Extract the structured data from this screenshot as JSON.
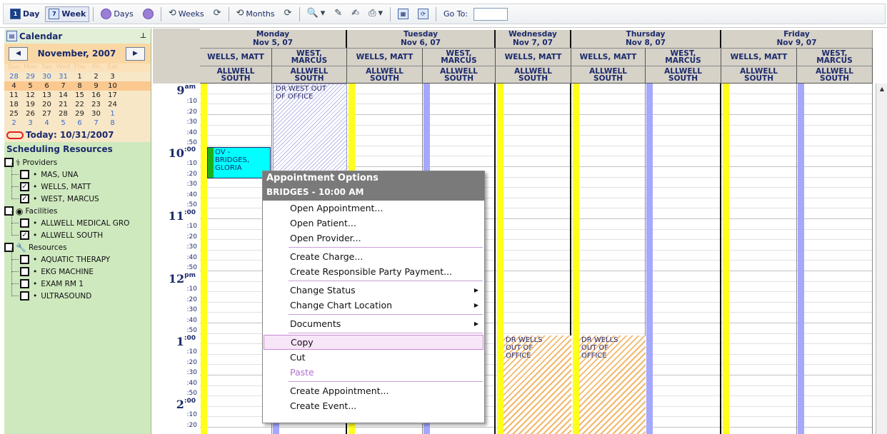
{
  "toolbar": {
    "day_label": "Day",
    "week_label": "Week",
    "days_label": "Days",
    "weeks_label": "Weeks",
    "months_label": "Months",
    "goto_label": "Go To:",
    "goto_value": ""
  },
  "sidebar": {
    "title": "Calendar",
    "month_label": "November, 2007",
    "dow": [
      "Sun",
      "Mon",
      "Tue",
      "Wed",
      "Thu",
      "Fri",
      "Sat"
    ],
    "weeks": [
      [
        "28",
        "29",
        "30",
        "31",
        "1",
        "2",
        "3"
      ],
      [
        "4",
        "5",
        "6",
        "7",
        "8",
        "9",
        "10"
      ],
      [
        "11",
        "12",
        "13",
        "14",
        "15",
        "16",
        "17"
      ],
      [
        "18",
        "19",
        "20",
        "21",
        "22",
        "23",
        "24"
      ],
      [
        "25",
        "26",
        "27",
        "28",
        "29",
        "30",
        "1"
      ],
      [
        "2",
        "3",
        "4",
        "5",
        "6",
        "7",
        "8"
      ]
    ],
    "today_label": "Today: 10/31/2007",
    "resources_title": "Scheduling Resources",
    "providers_label": "Providers",
    "providers": [
      {
        "name": "MAS, UNA",
        "checked": ""
      },
      {
        "name": "WELLS, MATT",
        "checked": "✓"
      },
      {
        "name": "WEST, MARCUS",
        "checked": "✓"
      }
    ],
    "facilities_label": "Facilities",
    "facilities": [
      {
        "name": "ALLWELL MEDICAL GRO",
        "checked": ""
      },
      {
        "name": "ALLWELL SOUTH",
        "checked": "✓"
      }
    ],
    "resources_label": "Resources",
    "resources": [
      {
        "name": "AQUATIC THERAPY",
        "checked": ""
      },
      {
        "name": "EKG MACHINE",
        "checked": ""
      },
      {
        "name": "EXAM RM 1",
        "checked": ""
      },
      {
        "name": "ULTRASOUND",
        "checked": ""
      }
    ]
  },
  "calendar": {
    "days": [
      {
        "name": "Monday",
        "date": "Nov 5, 07"
      },
      {
        "name": "Tuesday",
        "date": "Nov 6, 07"
      },
      {
        "name": "Wednesday",
        "date": "Nov 7, 07"
      },
      {
        "name": "Thursday",
        "date": "Nov 8, 07"
      },
      {
        "name": "Friday",
        "date": "Nov 9, 07"
      }
    ],
    "providers": {
      "wells": "WELLS, MATT",
      "west_l1": "WEST,",
      "west_l2": "MARCUS"
    },
    "facility": {
      "l1": "ALLWELL",
      "l2": "SOUTH"
    },
    "hours": [
      {
        "hour": "9",
        "suffix": "am"
      },
      {
        "hour": "10",
        "suffix": ":00"
      },
      {
        "hour": "11",
        "suffix": ":00"
      },
      {
        "hour": "12",
        "suffix": "pm"
      },
      {
        "hour": "1",
        "suffix": ":00"
      },
      {
        "hour": "2",
        "suffix": ":00"
      }
    ],
    "minutes": [
      ":10",
      ":20",
      ":30",
      ":40",
      ":50"
    ],
    "appointments": {
      "west_out_l1": "DR WEST OUT",
      "west_out_l2": "OF OFFICE",
      "ov_l1": "OV -",
      "ov_l2": "BRIDGES,",
      "ov_l3": "GLORIA",
      "wells_out_l1": "DR WELLS",
      "wells_out_l2": "OUT OF",
      "wells_out_l3": "OFFICE"
    }
  },
  "context_menu": {
    "title": "Appointment Options",
    "subtitle": "BRIDGES - 10:00 AM",
    "groups": [
      [
        "Open Appointment...",
        "Open Patient...",
        "Open Provider..."
      ],
      [
        "Create Charge...",
        "Create Responsible Party Payment..."
      ],
      [
        "Change Status",
        "Change Chart Location"
      ],
      [
        "Documents"
      ],
      [
        "Copy",
        "Cut",
        "Paste"
      ],
      [
        "Create Appointment...",
        "Create Event..."
      ]
    ]
  },
  "colors": {
    "accent_text": "#1b2a6b",
    "provider_strip_wells": "#ffff1a",
    "provider_strip_west": "#a5a8ff",
    "appointment_ov": "#00ffff",
    "sidebar_bg": "#cfe9bf"
  }
}
